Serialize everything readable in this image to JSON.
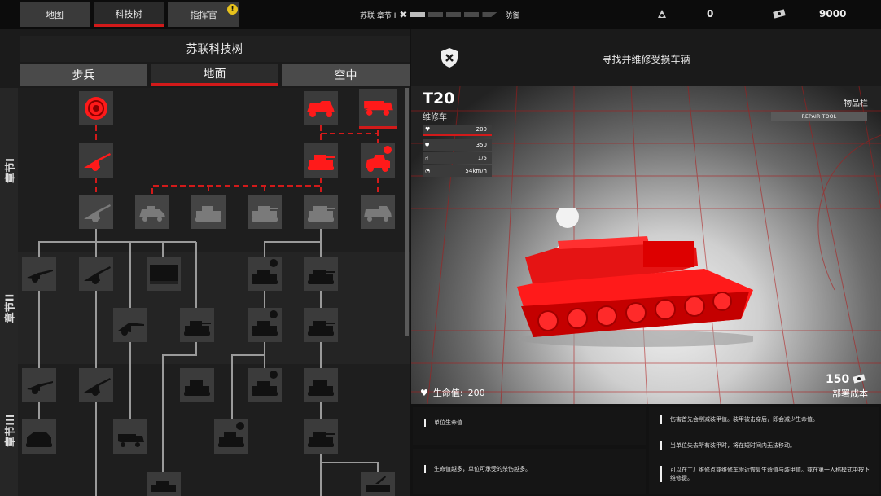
{
  "topbar": {
    "tabs": [
      {
        "label": "地图"
      },
      {
        "label": "科技树"
      },
      {
        "label": "指挥官",
        "badge": "!"
      }
    ],
    "chapter_label": "苏联 章节 I",
    "chapter_segments_done": 1,
    "chapter_segments_total": 5,
    "stance": "防御",
    "resource_count": "0",
    "money": "9000"
  },
  "tree": {
    "title": "苏联科技树",
    "categories": [
      {
        "label": "步兵"
      },
      {
        "label": "地面"
      },
      {
        "label": "空中"
      }
    ],
    "active_category": "地面",
    "chapters": [
      "章节I",
      "章节II",
      "章节III"
    ]
  },
  "detail": {
    "mission": "寻找并维修受损车辆",
    "unit_name": "T20",
    "unit_type": "维修车",
    "stats": {
      "health": "200",
      "armor": "350",
      "crew": "1/5",
      "speed": "54km/h"
    },
    "inventory_label": "物品栏",
    "inventory_item": "REPAIR TOOL",
    "hp_label": "生命值:",
    "hp_value": "200",
    "cost_value": "150",
    "cost_label": "部署成本",
    "notes_left": [
      "单位生命值",
      "生命值越多，单位可承受的杀伤越多。"
    ],
    "notes_right": [
      "伤害首先会削减装甲值。装甲被击穿后，即会减少生命值。",
      "当单位失去所有装甲时，将在短时间内无法移动。",
      "可以在工厂维修点或维修车附近恢复生命值与装甲值。或在第一人称模式中按下维修键。"
    ]
  },
  "colors": {
    "accent": "#d21a1a",
    "node_bg": "#3b3b3b",
    "unlocked": "#ff1a1a"
  }
}
